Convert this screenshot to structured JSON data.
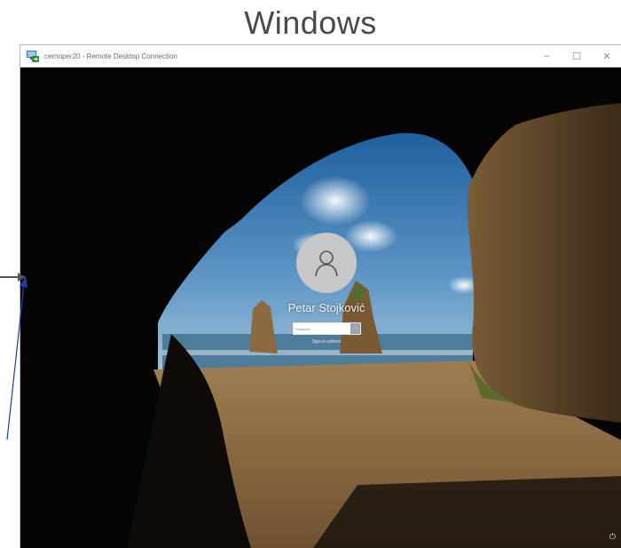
{
  "heading": "Windows",
  "window": {
    "title": "cernoper20 - Remote Desktop Connection",
    "app_icon": "remote-desktop-icon",
    "controls": {
      "minimize": "–",
      "maximize": "☐",
      "close": "✕"
    }
  },
  "login": {
    "user_name": "Petar Stojković",
    "avatar_icon": "user-silhouette-icon",
    "password_placeholder": "Password",
    "submit_icon": "arrow-right-icon",
    "sign_in_options": "Sign-in options"
  },
  "system": {
    "power_icon": "power-icon"
  },
  "colors": {
    "arrow_grey": "#555555",
    "arrow_blue": "#1f3fa0",
    "sky": "#2f78b8",
    "sand": "#8a6a42",
    "rock": "#5a4328"
  }
}
